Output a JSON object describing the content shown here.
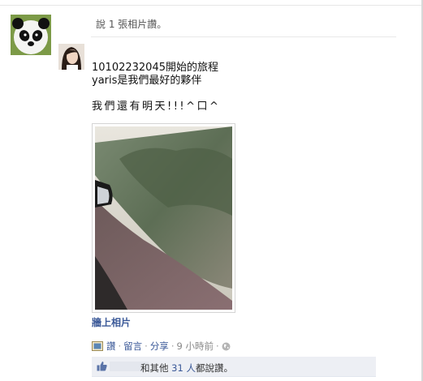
{
  "story": {
    "header": "說 1 張相片讚。",
    "post_lines": [
      "10102232045開始的旅程",
      "yaris是我們最好的夥伴"
    ],
    "post_exclaim": "我們還有明天!!!^口^",
    "upload_link": "牆上相片"
  },
  "actions": {
    "like": "讚",
    "comment": "留言",
    "share": "分享",
    "time": "9 小時前",
    "separator": "·"
  },
  "likes": {
    "text_prefix": "和其他",
    "count_link": "31 人",
    "text_suffix": "都說讚。"
  },
  "colors": {
    "link": "#3b5998",
    "likes_bg": "#edeff4"
  },
  "icons": [
    "panda-avatar",
    "friend-avatar",
    "photo-icon",
    "globe-icon",
    "like-thumb-icon"
  ]
}
